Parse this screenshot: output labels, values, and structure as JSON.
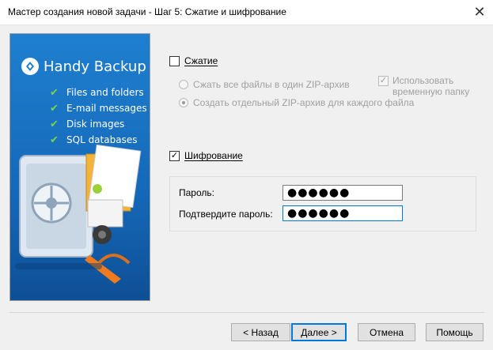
{
  "window": {
    "title": "Мастер создания новой задачи - Шаг 5: Сжатие и шифрование",
    "close_glyph": "✕"
  },
  "banner": {
    "logo_text": "Handy Backup",
    "features": [
      "Files and folders",
      "E-mail messages",
      "Disk images",
      "SQL databases"
    ]
  },
  "compression": {
    "label": "Сжатие",
    "checked": false,
    "options": [
      {
        "label": "Сжать все файлы в один ZIP-архив",
        "selected": false
      },
      {
        "label": "Создать отдельный ZIP-архив для каждого файла",
        "selected": true
      }
    ],
    "temp_folder_label_line1": "Использовать",
    "temp_folder_label_line2": "временную папку",
    "temp_folder_checked": true
  },
  "encryption": {
    "label": "Шифрование",
    "checked": true,
    "password_label": "Пароль:",
    "password_value": "●●●●●●",
    "confirm_label": "Подтвердите пароль:",
    "confirm_value": "●●●●●●"
  },
  "buttons": {
    "back": "< Назад",
    "next": "Далее >",
    "cancel": "Отмена",
    "help": "Помощь"
  },
  "colors": {
    "banner": "#1a73c8",
    "accent": "#0078d7",
    "check": "#7cd34a"
  }
}
